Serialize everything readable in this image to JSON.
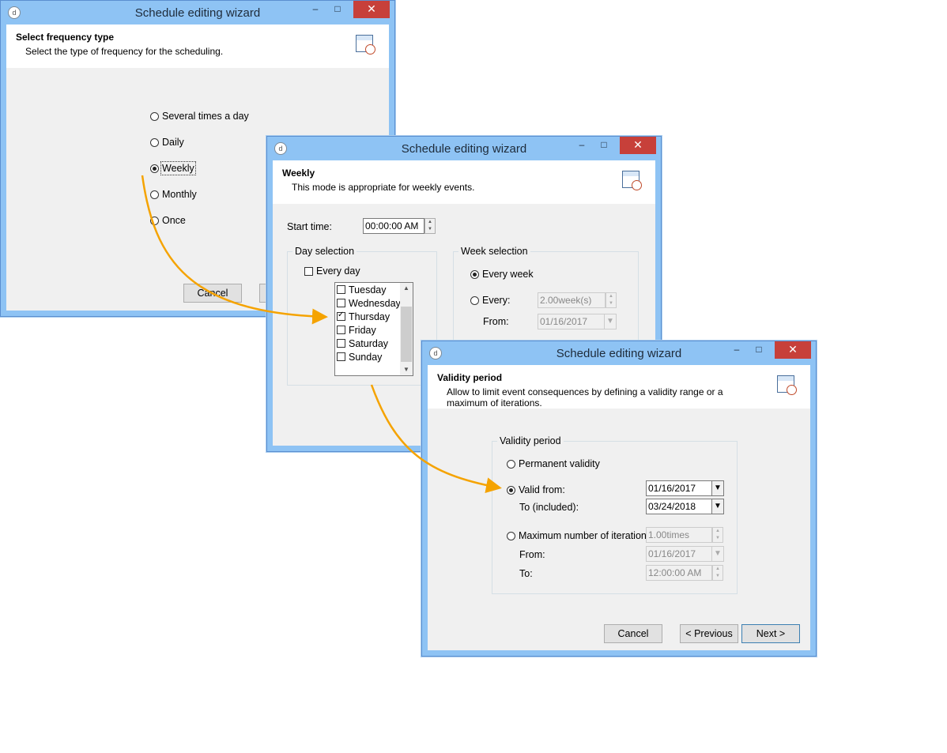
{
  "window_title": "Schedule editing wizard",
  "titlebar_controls": {
    "minimize": "–",
    "maximize": "□",
    "close": "✕"
  },
  "app_icon_glyph": "d",
  "win1": {
    "header_title": "Select frequency type",
    "header_desc": "Select the type of frequency for the scheduling.",
    "options": [
      "Several times a day",
      "Daily",
      "Weekly",
      "Monthly",
      "Once"
    ],
    "selected": "Weekly",
    "cancel": "Cancel"
  },
  "win2": {
    "header_title": "Weekly",
    "header_desc": "This mode is appropriate for weekly events.",
    "start_time_label": "Start time:",
    "start_time_value": "00:00:00 AM",
    "day_selection_label": "Day selection",
    "every_day_label": "Every day",
    "days": [
      "Tuesday",
      "Wednesday",
      "Thursday",
      "Friday",
      "Saturday",
      "Sunday"
    ],
    "checked_day": "Thursday",
    "week_selection_label": "Week selection",
    "every_week_label": "Every week",
    "every_label": "Every:",
    "every_value": "2.00week(s)",
    "from_label": "From:",
    "from_value": "01/16/2017"
  },
  "win3": {
    "header_title": "Validity period",
    "header_desc": "Allow to limit event consequences by defining a validity range or a maximum of iterations.",
    "group_label": "Validity period",
    "permanent_label": "Permanent validity",
    "valid_from_label": "Valid from:",
    "valid_from_value": "01/16/2017",
    "to_included_label": "To (included):",
    "to_included_value": "03/24/2018",
    "max_iter_label": "Maximum number of iteration",
    "max_iter_value": "1.00times",
    "from_label": "From:",
    "from_value": "01/16/2017",
    "to_label": "To:",
    "to_value": "12:00:00 AM",
    "cancel": "Cancel",
    "previous": "< Previous",
    "next": "Next >"
  },
  "colors": {
    "titlebar": "#8ec3f4",
    "close": "#c7403a",
    "arrow": "#f5a300"
  }
}
